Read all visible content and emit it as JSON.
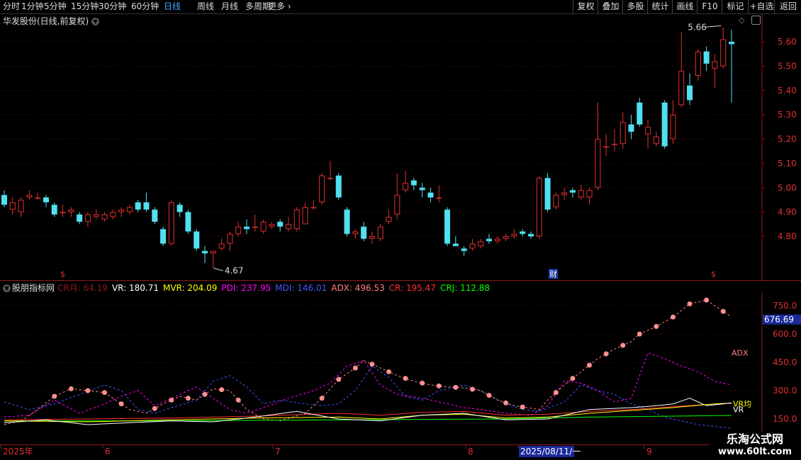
{
  "toolbar": {
    "left_items": [
      "分时",
      "1分钟",
      "5分钟",
      "15分钟",
      "30分钟",
      "60分钟",
      "日线",
      "周线",
      "月线",
      "多周期",
      "更多"
    ],
    "active": "日线",
    "right_items": [
      "复权",
      "叠加",
      "多股",
      "统计",
      "画线",
      "F10",
      "标记",
      "+自选",
      "返回"
    ]
  },
  "main_chart": {
    "title": "华发股份(日线,前复权)",
    "high_label": "5.66",
    "low_label": "4.67",
    "price_ticks": [
      "5.60",
      "5.50",
      "5.40",
      "5.30",
      "5.20",
      "5.10",
      "5.00",
      "4.90",
      "4.80"
    ],
    "marker_s1": "$",
    "marker_cai": "财",
    "marker_s2": "$"
  },
  "indicator": {
    "title": "股朋指标网",
    "legend": [
      {
        "text": "CR月: 64.19",
        "color": "#8b1a1a"
      },
      {
        "text": "VR: 180.71",
        "color": "#ffffff"
      },
      {
        "text": "MVR: 204.09",
        "color": "#ffff00"
      },
      {
        "text": "PDI: 237.95",
        "color": "#ff00ff"
      },
      {
        "text": "MDI: 146.01",
        "color": "#3b5bff"
      },
      {
        "text": "ADX: 496.53",
        "color": "#ff8080"
      },
      {
        "text": "CR: 195.47",
        "color": "#ff3030"
      },
      {
        "text": "CRJ: 112.88",
        "color": "#00ff00"
      }
    ],
    "ticks": [
      "750.0",
      "600.0",
      "450.0",
      "300.0",
      "150.0"
    ],
    "current_value": "676.69",
    "label_adx": "ADX",
    "label_vr_avg": "VR均",
    "label_vr": "VR"
  },
  "date_axis": {
    "labels": [
      "2025年",
      "6",
      "7",
      "8",
      "2025/08/11/一",
      "9"
    ]
  },
  "watermark": {
    "line1": "乐淘公式网",
    "line2": "www.60lt.com"
  },
  "chart_data": {
    "type": "candlestick",
    "title": "华发股份(日线,前复权)",
    "price_range": [
      4.63,
      5.72
    ],
    "candles": [
      [
        4.97,
        4.93,
        4.99,
        4.92
      ],
      [
        4.91,
        4.94,
        4.96,
        4.89
      ],
      [
        4.9,
        4.95,
        4.96,
        4.88
      ],
      [
        4.96,
        4.97,
        4.99,
        4.95
      ],
      [
        4.96,
        4.96,
        4.98,
        4.95
      ],
      [
        4.96,
        4.94,
        4.97,
        4.92
      ],
      [
        4.93,
        4.89,
        4.94,
        4.88
      ],
      [
        4.9,
        4.9,
        4.93,
        4.88
      ],
      [
        4.9,
        4.91,
        4.92,
        4.88
      ],
      [
        4.89,
        4.86,
        4.9,
        4.85
      ],
      [
        4.86,
        4.89,
        4.9,
        4.84
      ],
      [
        4.88,
        4.89,
        4.91,
        4.87
      ],
      [
        4.87,
        4.89,
        4.9,
        4.86
      ],
      [
        4.88,
        4.9,
        4.91,
        4.87
      ],
      [
        4.9,
        4.91,
        4.92,
        4.88
      ],
      [
        4.9,
        4.92,
        4.93,
        4.89
      ],
      [
        4.94,
        4.91,
        4.95,
        4.9
      ],
      [
        4.94,
        4.91,
        4.98,
        4.9
      ],
      [
        4.91,
        4.86,
        4.92,
        4.85
      ],
      [
        4.83,
        4.77,
        4.84,
        4.76
      ],
      [
        4.77,
        4.94,
        4.95,
        4.76
      ],
      [
        4.93,
        4.9,
        4.94,
        4.88
      ],
      [
        4.9,
        4.82,
        4.91,
        4.81
      ],
      [
        4.82,
        4.75,
        4.83,
        4.74
      ],
      [
        4.74,
        4.73,
        4.76,
        4.69
      ],
      [
        4.73,
        4.74,
        4.74,
        4.67
      ],
      [
        4.75,
        4.77,
        4.79,
        4.74
      ],
      [
        4.77,
        4.81,
        4.82,
        4.74
      ],
      [
        4.81,
        4.84,
        4.86,
        4.8
      ],
      [
        4.84,
        4.83,
        4.87,
        4.81
      ],
      [
        4.84,
        4.84,
        4.89,
        4.82
      ],
      [
        4.82,
        4.86,
        4.87,
        4.81
      ],
      [
        4.84,
        4.85,
        4.86,
        4.83
      ],
      [
        4.86,
        4.84,
        4.87,
        4.82
      ],
      [
        4.83,
        4.85,
        4.88,
        4.82
      ],
      [
        4.83,
        4.91,
        4.92,
        4.82
      ],
      [
        4.85,
        4.92,
        4.94,
        4.85
      ],
      [
        4.92,
        4.92,
        4.95,
        4.91
      ],
      [
        4.94,
        5.05,
        5.06,
        4.93
      ],
      [
        5.04,
        5.04,
        5.11,
        5.03
      ],
      [
        5.05,
        4.96,
        5.06,
        4.95
      ],
      [
        4.91,
        4.81,
        4.92,
        4.8
      ],
      [
        4.81,
        4.82,
        4.83,
        4.79
      ],
      [
        4.84,
        4.79,
        4.86,
        4.78
      ],
      [
        4.79,
        4.8,
        4.82,
        4.77
      ],
      [
        4.79,
        4.84,
        4.85,
        4.78
      ],
      [
        4.86,
        4.88,
        4.91,
        4.85
      ],
      [
        4.89,
        4.97,
        5.06,
        4.87
      ],
      [
        4.99,
        5.02,
        5.07,
        4.98
      ],
      [
        5.03,
        5.01,
        5.04,
        4.99
      ],
      [
        5.0,
        4.99,
        5.02,
        4.96
      ],
      [
        4.98,
        4.96,
        5.0,
        4.94
      ],
      [
        4.96,
        4.96,
        5.01,
        4.94
      ],
      [
        4.91,
        4.77,
        4.92,
        4.76
      ],
      [
        4.77,
        4.76,
        4.8,
        4.76
      ],
      [
        4.75,
        4.74,
        4.76,
        4.72
      ],
      [
        4.75,
        4.77,
        4.79,
        4.74
      ],
      [
        4.76,
        4.78,
        4.79,
        4.75
      ],
      [
        4.79,
        4.78,
        4.81,
        4.77
      ],
      [
        4.78,
        4.79,
        4.8,
        4.77
      ],
      [
        4.79,
        4.8,
        4.81,
        4.78
      ],
      [
        4.8,
        4.81,
        4.83,
        4.79
      ],
      [
        4.82,
        4.81,
        4.83,
        4.8
      ],
      [
        4.81,
        4.8,
        4.82,
        4.79
      ],
      [
        4.8,
        5.04,
        5.05,
        4.79
      ],
      [
        5.04,
        4.91,
        5.06,
        4.9
      ],
      [
        4.92,
        4.97,
        4.98,
        4.91
      ],
      [
        4.97,
        4.98,
        5.0,
        4.95
      ],
      [
        4.99,
        4.98,
        5.0,
        4.96
      ],
      [
        4.96,
        4.99,
        5.01,
        4.95
      ],
      [
        4.96,
        4.99,
        5.0,
        4.93
      ],
      [
        5.0,
        5.2,
        5.35,
        4.99
      ],
      [
        5.17,
        5.17,
        5.22,
        5.13
      ],
      [
        5.18,
        5.18,
        5.24,
        5.15
      ],
      [
        5.18,
        5.27,
        5.31,
        5.16
      ],
      [
        5.26,
        5.23,
        5.3,
        5.2
      ],
      [
        5.35,
        5.26,
        5.37,
        5.25
      ],
      [
        5.22,
        5.25,
        5.28,
        5.16
      ],
      [
        5.18,
        5.21,
        5.23,
        5.17
      ],
      [
        5.35,
        5.17,
        5.36,
        5.16
      ],
      [
        5.2,
        5.3,
        5.36,
        5.18
      ],
      [
        5.34,
        5.48,
        5.64,
        5.33
      ],
      [
        5.42,
        5.36,
        5.47,
        5.34
      ],
      [
        5.46,
        5.56,
        5.57,
        5.44
      ],
      [
        5.56,
        5.51,
        5.58,
        5.48
      ],
      [
        5.49,
        5.52,
        5.55,
        5.41
      ],
      [
        5.5,
        5.61,
        5.66,
        5.49
      ],
      [
        5.6,
        5.59,
        5.65,
        5.35
      ]
    ],
    "indicator_range": [
      60,
      800
    ],
    "indicator_series": [
      {
        "name": "ADX",
        "color": "#ff8080",
        "style": "dotted-markers"
      },
      {
        "name": "PDI",
        "color": "#ff00ff",
        "style": "dashed"
      },
      {
        "name": "MDI",
        "color": "#3b5bff",
        "style": "dashed"
      },
      {
        "name": "VR",
        "color": "#ffffff",
        "style": "line"
      },
      {
        "name": "MVR",
        "color": "#ffff00",
        "style": "line"
      },
      {
        "name": "CR",
        "color": "#ff3030",
        "style": "line"
      },
      {
        "name": "CRJ",
        "color": "#00ff00",
        "style": "line"
      }
    ]
  }
}
